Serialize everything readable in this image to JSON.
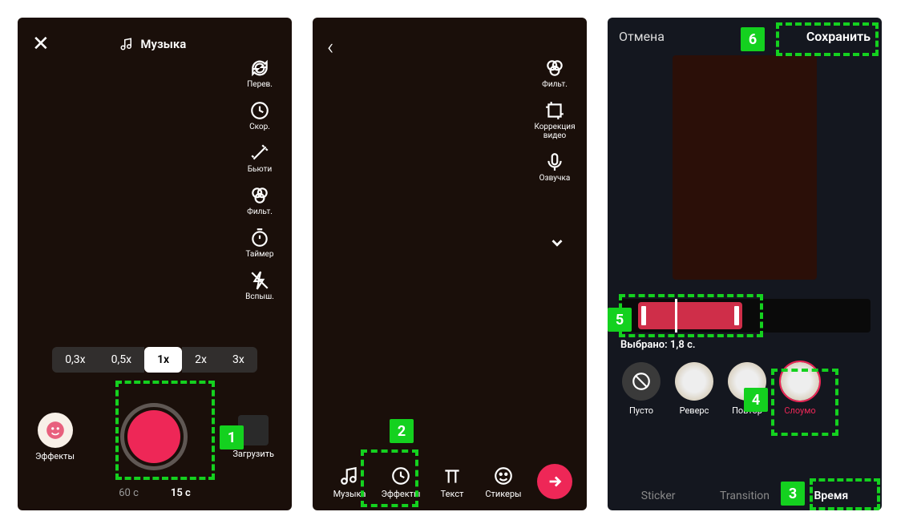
{
  "screen1": {
    "music_label": "Музыка",
    "tools": [
      "Перев.",
      "Скор.",
      "Бьюти",
      "Фильт.",
      "Таймер",
      "Вспыш."
    ],
    "speeds": [
      "0,3x",
      "0,5x",
      "1x",
      "2x",
      "3x"
    ],
    "speed_active_index": 2,
    "effects_label": "Эффекты",
    "upload_label": "Загрузить",
    "durations": [
      "60 с",
      "15 с"
    ],
    "duration_active_index": 1,
    "badge": "1"
  },
  "screen2": {
    "tools": [
      "Фильт.",
      "Коррекция видео",
      "Озвучка"
    ],
    "bottom": [
      "Музыка",
      "Эффекты",
      "Текст",
      "Стикеры"
    ],
    "badge": "2"
  },
  "screen3": {
    "cancel": "Отмена",
    "save": "Сохранить",
    "selected": "Выбрано: 1,8 с.",
    "effects": [
      "Пусто",
      "Реверс",
      "Повтор",
      "Слоумо"
    ],
    "effects_active_index": 3,
    "tabs": [
      "Sticker",
      "Transition",
      "Время"
    ],
    "tabs_active_index": 2,
    "badges": {
      "tab": "3",
      "effect": "4",
      "timeline": "5",
      "save": "6"
    }
  }
}
